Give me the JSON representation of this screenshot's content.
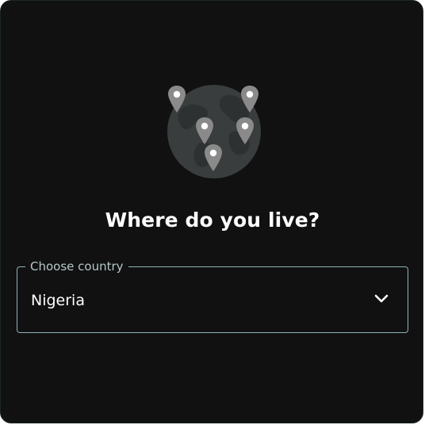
{
  "illustration": {
    "icon": "globe-with-location-pins-icon",
    "globe_color": "#3a3d3e",
    "continent_color": "#2e3132",
    "pin_color": "#8a8a8a",
    "pin_dot_color": "#ffffff"
  },
  "heading": "Where do you live?",
  "country_select": {
    "label": "Choose country",
    "value": "Nigeria",
    "icon": "chevron-down-icon",
    "border_color": "#8fb3b8"
  },
  "colors": {
    "background": "#111111",
    "text": "#ffffff",
    "label": "#b5c7ca"
  }
}
